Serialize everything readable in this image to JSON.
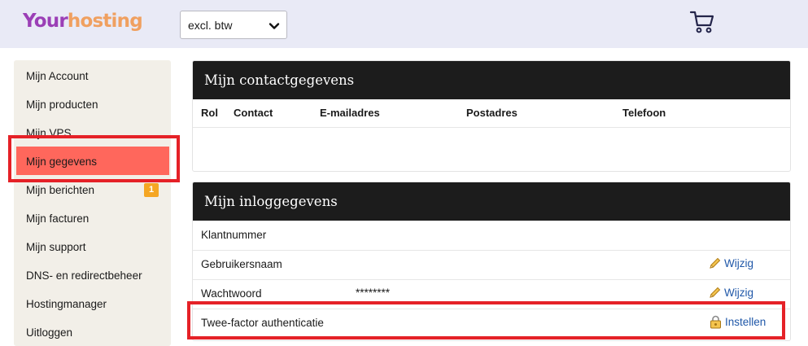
{
  "header": {
    "logo_part1": "Your",
    "logo_part2": "hosting",
    "vat_select_value": "excl. btw",
    "cart_icon": "shopping-cart-icon"
  },
  "sidebar": {
    "items": [
      {
        "label": "Mijn Account"
      },
      {
        "label": "Mijn producten"
      },
      {
        "label": "Mijn VPS"
      },
      {
        "label": "Mijn gegevens",
        "active": true
      },
      {
        "label": "Mijn berichten",
        "badge": "1"
      },
      {
        "label": "Mijn facturen"
      },
      {
        "label": "Mijn support"
      },
      {
        "label": "DNS- en redirectbeheer"
      },
      {
        "label": "Hostingmanager"
      },
      {
        "label": "Uitloggen"
      }
    ]
  },
  "contact_panel": {
    "title": "Mijn contactgegevens",
    "columns": [
      "Rol",
      "Contact",
      "E-mailadres",
      "Postadres",
      "Telefoon"
    ]
  },
  "login_panel": {
    "title": "Mijn inloggegevens",
    "rows": [
      {
        "key": "Klantnummer",
        "value": "",
        "action": ""
      },
      {
        "key": "Gebruikersnaam",
        "value": "",
        "action": "Wijzig",
        "icon": "pencil-icon"
      },
      {
        "key": "Wachtwoord",
        "value": "********",
        "action": "Wijzig",
        "icon": "pencil-icon"
      },
      {
        "key": "Twee-factor authenticatie",
        "value": "",
        "action": "Instellen",
        "icon": "settings-padlock-icon"
      }
    ]
  },
  "colors": {
    "header_bg": "#e9eaf6",
    "logo_purple": "#9b3fb6",
    "logo_orange": "#f0a060",
    "sidebar_bg": "#f2efe8",
    "active_item": "#ff675c",
    "badge": "#f5a623",
    "panel_header": "#1c1c1c",
    "link": "#1f57a8",
    "highlight_box": "#e52127"
  }
}
